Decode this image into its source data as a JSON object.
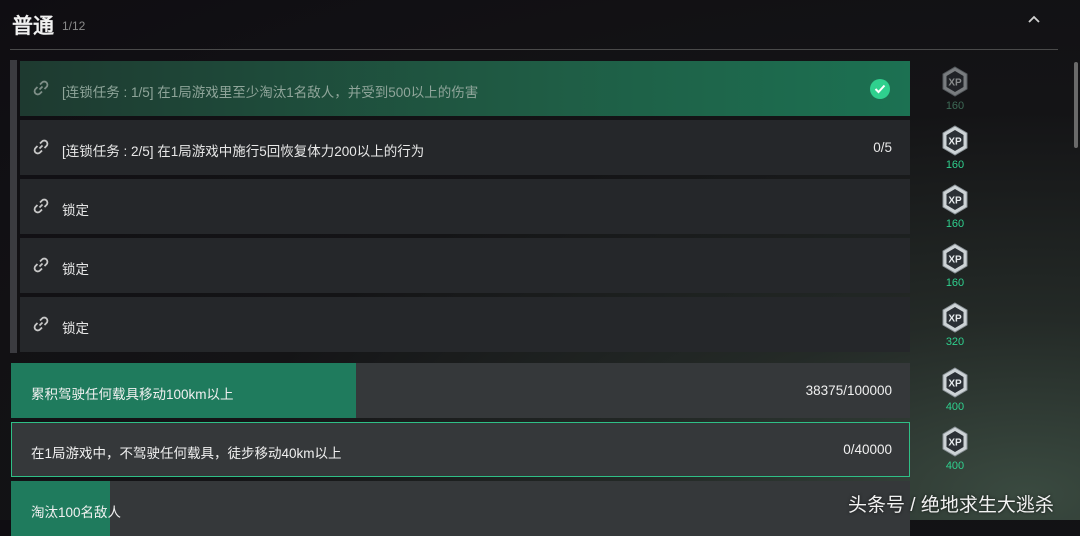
{
  "header": {
    "title": "普通",
    "count": "1/12"
  },
  "chain_tasks": [
    {
      "text": "[连锁任务 : 1/5] 在1局游戏里至少淘汰1名敌人，并受到500以上的伤害",
      "completed": true,
      "progress": ""
    },
    {
      "text": "[连锁任务 : 2/5] 在1局游戏中施行5回恢复体力200以上的行为",
      "completed": false,
      "progress": "0/5"
    },
    {
      "text": "锁定",
      "completed": false,
      "progress": ""
    },
    {
      "text": "锁定",
      "completed": false,
      "progress": ""
    },
    {
      "text": "锁定",
      "completed": false,
      "progress": ""
    }
  ],
  "missions": [
    {
      "text": "累积驾驶任何载具移动100km以上",
      "progress": "38375/100000",
      "fill_fraction": 0.38375
    },
    {
      "text": "在1局游戏中，不驾驶任何载具，徒步移动40km以上",
      "progress": "0/40000",
      "fill_fraction": 0
    },
    {
      "text": "淘汰100名敌人",
      "progress": "",
      "fill_fraction": 0.11
    }
  ],
  "xp_rewards": [
    {
      "badge": "XP",
      "amount": "160",
      "claimed": true
    },
    {
      "badge": "XP",
      "amount": "160",
      "claimed": false
    },
    {
      "badge": "XP",
      "amount": "160",
      "claimed": false
    },
    {
      "badge": "XP",
      "amount": "160",
      "claimed": false
    },
    {
      "badge": "XP",
      "amount": "320",
      "claimed": false
    },
    {
      "badge": "XP",
      "amount": "400",
      "claimed": false
    },
    {
      "badge": "XP",
      "amount": "400",
      "claimed": false
    }
  ],
  "watermark": "头条号 / 绝地求生大逃杀",
  "icons": {
    "collapse": "chevron-up-icon",
    "chain": "link-icon",
    "done": "check-icon",
    "reward": "xp-badge-icon"
  },
  "colors": {
    "accent": "#2fd08e",
    "progress_fill": "#1f7b5d",
    "completed_row": "#1f5d45"
  }
}
